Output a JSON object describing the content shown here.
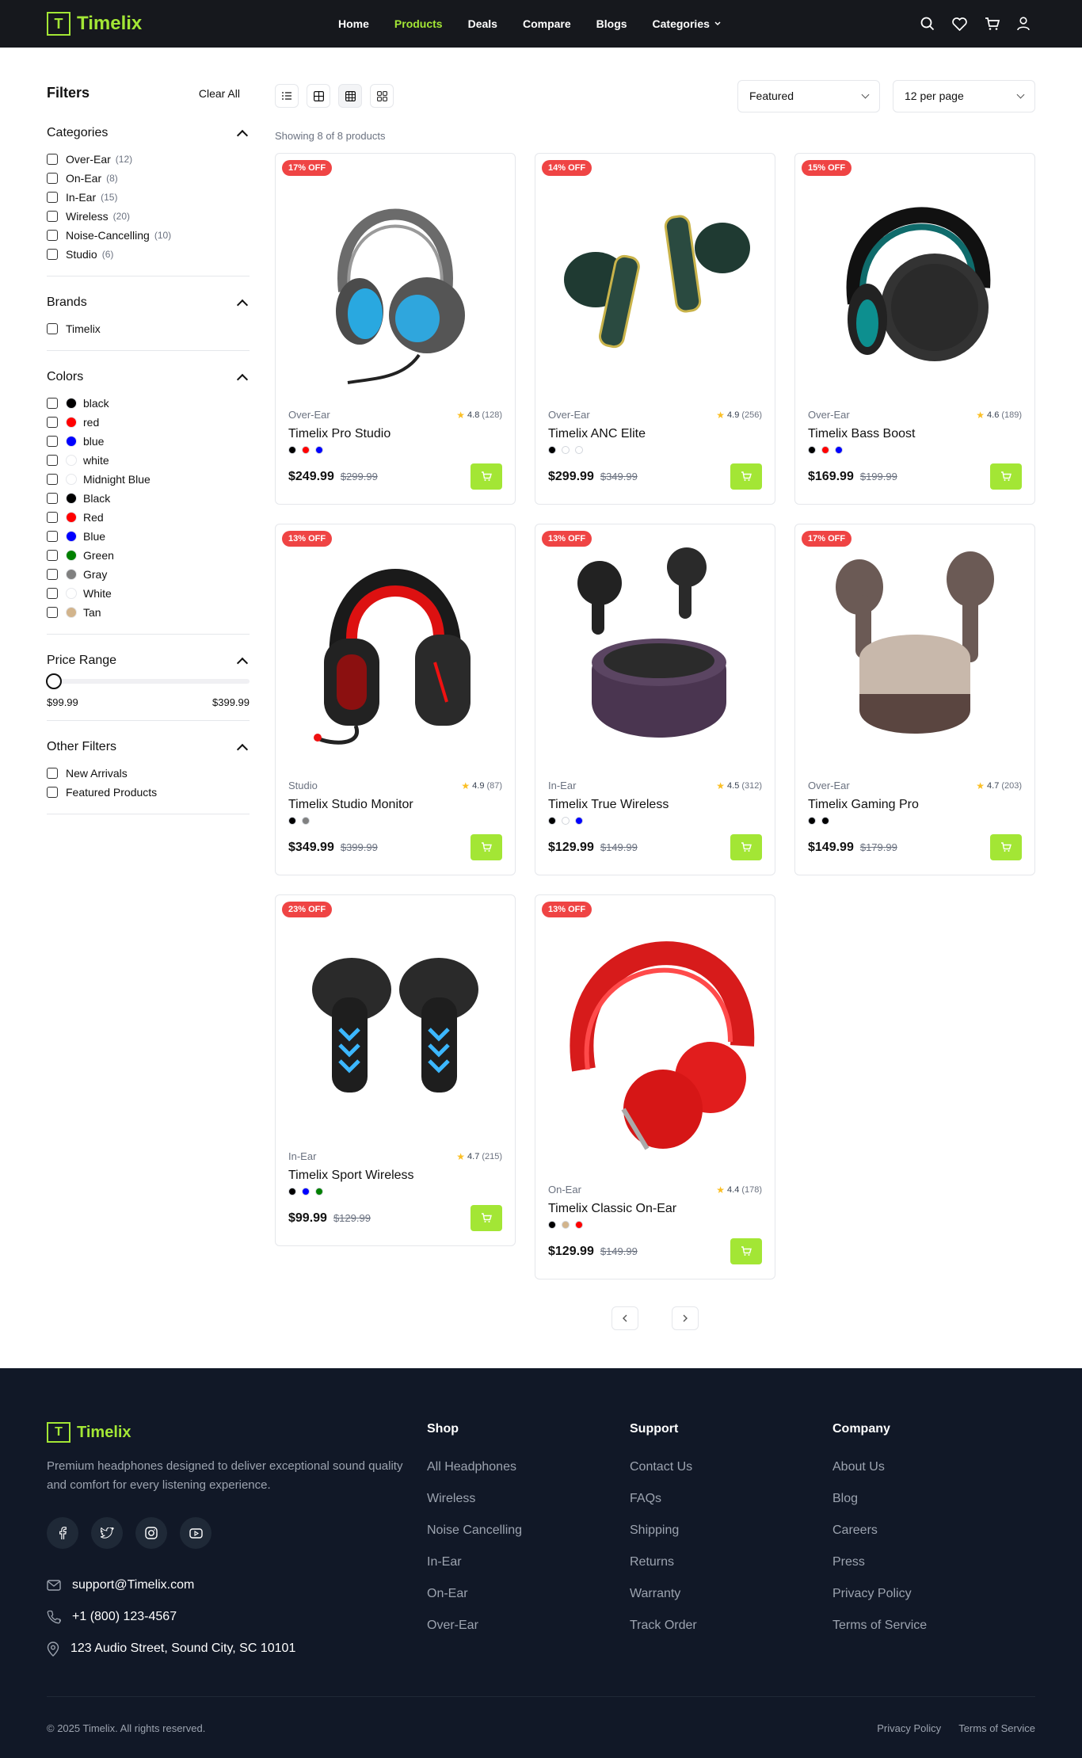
{
  "brand": {
    "logo_letter": "T",
    "name": "Timelix"
  },
  "nav": {
    "items": [
      "Home",
      "Products",
      "Deals",
      "Compare",
      "Blogs",
      "Categories"
    ]
  },
  "filters": {
    "title": "Filters",
    "clear_all": "Clear All",
    "categories": {
      "title": "Categories",
      "items": [
        {
          "label": "Over-Ear",
          "count": "(12)"
        },
        {
          "label": "On-Ear",
          "count": "(8)"
        },
        {
          "label": "In-Ear",
          "count": "(15)"
        },
        {
          "label": "Wireless",
          "count": "(20)"
        },
        {
          "label": "Noise-Cancelling",
          "count": "(10)"
        },
        {
          "label": "Studio",
          "count": "(6)"
        }
      ]
    },
    "brands": {
      "title": "Brands",
      "items": [
        "Timelix"
      ]
    },
    "colors": {
      "title": "Colors",
      "items": [
        {
          "label": "black",
          "hex": "#000000"
        },
        {
          "label": "red",
          "hex": "#ff0000"
        },
        {
          "label": "blue",
          "hex": "#0000ff"
        },
        {
          "label": "white",
          "hex": "#ffffff"
        },
        {
          "label": "Midnight Blue",
          "hex": "#ffffff"
        },
        {
          "label": "Black",
          "hex": "#000000"
        },
        {
          "label": "Red",
          "hex": "#ff0000"
        },
        {
          "label": "Blue",
          "hex": "#0000ff"
        },
        {
          "label": "Green",
          "hex": "#008000"
        },
        {
          "label": "Gray",
          "hex": "#808080"
        },
        {
          "label": "White",
          "hex": "#ffffff"
        },
        {
          "label": "Tan",
          "hex": "#d2b48c"
        }
      ]
    },
    "price": {
      "title": "Price Range",
      "min": "$99.99",
      "max": "$399.99"
    },
    "other": {
      "title": "Other Filters",
      "items": [
        "New Arrivals",
        "Featured Products"
      ]
    }
  },
  "toolbar": {
    "sort": "Featured",
    "per_page": "12 per page",
    "showing": "Showing 8 of 8 products"
  },
  "products": [
    {
      "badge": "17% OFF",
      "category": "Over-Ear",
      "rating": "4.8",
      "reviews": "(128)",
      "name": "Timelix Pro Studio",
      "colors": [
        "#000000",
        "#ff0000",
        "#0000ff"
      ],
      "price": "$249.99",
      "old_price": "$299.99",
      "image": "over-ear-blue-headphones"
    },
    {
      "badge": "14% OFF",
      "category": "Over-Ear",
      "rating": "4.9",
      "reviews": "(256)",
      "name": "Timelix ANC Elite",
      "colors": [
        "#000000",
        "#ffffff",
        "#ffffff"
      ],
      "price": "$299.99",
      "old_price": "$349.99",
      "image": "green-gold-earbuds"
    },
    {
      "badge": "15% OFF",
      "category": "Over-Ear",
      "rating": "4.6",
      "reviews": "(189)",
      "name": "Timelix Bass Boost",
      "colors": [
        "#000000",
        "#ff0000",
        "#0000ff"
      ],
      "price": "$169.99",
      "old_price": "$199.99",
      "image": "black-teal-headphones"
    },
    {
      "badge": "13% OFF",
      "category": "Studio",
      "rating": "4.9",
      "reviews": "(87)",
      "name": "Timelix Studio Monitor",
      "colors": [
        "#000000",
        "#808080"
      ],
      "price": "$349.99",
      "old_price": "$399.99",
      "image": "red-black-gaming-headset"
    },
    {
      "badge": "13% OFF",
      "category": "In-Ear",
      "rating": "4.5",
      "reviews": "(312)",
      "name": "Timelix True Wireless",
      "colors": [
        "#000000",
        "#ffffff",
        "#0000ff"
      ],
      "price": "$129.99",
      "old_price": "$149.99",
      "image": "purple-earbuds-case"
    },
    {
      "badge": "17% OFF",
      "category": "Over-Ear",
      "rating": "4.7",
      "reviews": "(203)",
      "name": "Timelix Gaming Pro",
      "colors": [
        "#000000",
        "#000000"
      ],
      "price": "$149.99",
      "old_price": "$179.99",
      "image": "brown-earbuds-case"
    },
    {
      "badge": "23% OFF",
      "category": "In-Ear",
      "rating": "4.7",
      "reviews": "(215)",
      "name": "Timelix Sport Wireless",
      "colors": [
        "#000000",
        "#0000ff",
        "#008000"
      ],
      "price": "$99.99",
      "old_price": "$129.99",
      "image": "black-blue-gaming-earbuds"
    },
    {
      "badge": "13% OFF",
      "category": "On-Ear",
      "rating": "4.4",
      "reviews": "(178)",
      "name": "Timelix Classic On-Ear",
      "colors": [
        "#000000",
        "#d2b48c",
        "#ff0000"
      ],
      "price": "$129.99",
      "old_price": "$149.99",
      "image": "red-on-ear-headphones"
    }
  ],
  "footer": {
    "brand_letter": "T",
    "brand_name": "Timelix",
    "description": "Premium headphones designed to deliver exceptional sound quality and comfort for every listening experience.",
    "email": "support@Timelix.com",
    "phone": "+1 (800) 123-4567",
    "address": "123 Audio Street, Sound City, SC 10101",
    "columns": [
      {
        "title": "Shop",
        "links": [
          "All Headphones",
          "Wireless",
          "Noise Cancelling",
          "In-Ear",
          "On-Ear",
          "Over-Ear"
        ]
      },
      {
        "title": "Support",
        "links": [
          "Contact Us",
          "FAQs",
          "Shipping",
          "Returns",
          "Warranty",
          "Track Order"
        ]
      },
      {
        "title": "Company",
        "links": [
          "About Us",
          "Blog",
          "Careers",
          "Press",
          "Privacy Policy",
          "Terms of Service"
        ]
      }
    ],
    "copyright": "© 2025 Timelix. All rights reserved.",
    "bottom_links": [
      "Privacy Policy",
      "Terms of Service"
    ]
  }
}
